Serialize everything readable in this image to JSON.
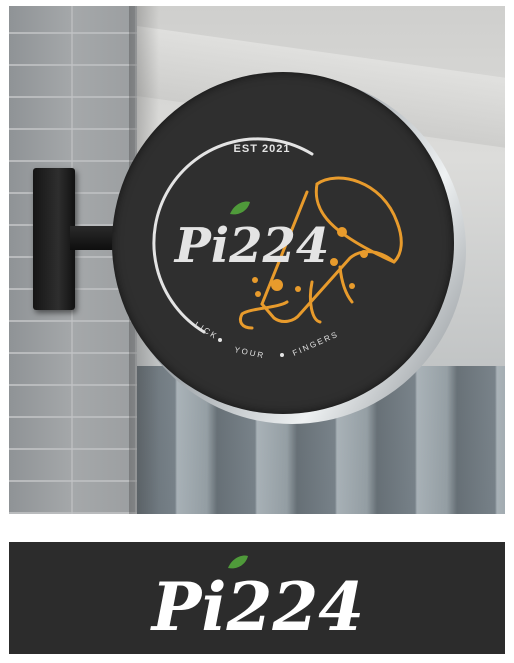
{
  "brand": {
    "name": "Pi224",
    "established": "EST 2021",
    "tagline": [
      "LICK",
      "YOUR",
      "FINGERS"
    ]
  },
  "colors": {
    "sign_face": "#2f2f2f",
    "logo_text": "#e4e4e4",
    "pizza_orange": "#e89b2c",
    "leaf_green": "#4f9a3a",
    "panel_background": "#2c2c2c"
  },
  "icons": [
    "pizza-slice-icon",
    "leaf-icon",
    "wall-bracket"
  ]
}
